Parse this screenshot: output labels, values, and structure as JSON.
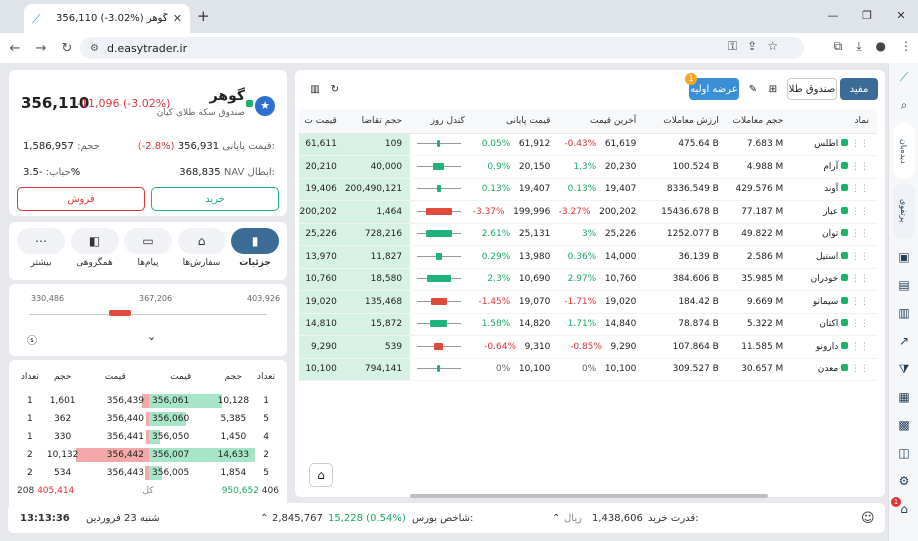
{
  "browser": {
    "tab_title": "356,110 (-3.02%) گوهر",
    "url": "d.easytrader.ir"
  },
  "stock": {
    "name": "گوهر",
    "subtitle": "صندوق سکه طلای کیان",
    "price": "356,110",
    "change": "-11,096 (-3.02%)",
    "final_price_label": "قیمت پایانی:",
    "final_price": "356,931",
    "final_change": "(-2.8%)",
    "volume_label": "حجم:",
    "volume": "1,586,957",
    "nav_label": "NAV ابطال:",
    "nav": "368,835",
    "bubble_label": "حباب:",
    "bubble": "-3.5%",
    "buy_label": "خرید",
    "sell_label": "فروش"
  },
  "panel_tabs": [
    {
      "label": "جزئیات",
      "icon": "chart-icon",
      "active": true
    },
    {
      "label": "سفارش‌ها",
      "icon": "basket-icon",
      "active": false
    },
    {
      "label": "پیام‌ها",
      "icon": "message-icon",
      "active": false
    },
    {
      "label": "همگروهی",
      "icon": "group-icon",
      "active": false
    },
    {
      "label": "بیشتر",
      "icon": "more-icon",
      "active": false
    }
  ],
  "range": {
    "low": "330,486",
    "mid": "367,206",
    "high": "403,926"
  },
  "orderbook": {
    "headers": {
      "count": "تعداد",
      "volume": "حجم",
      "price": "قیمت"
    },
    "rows": [
      {
        "buy_count": "1",
        "buy_vol": "10,128",
        "buy_price": "356,061",
        "sell_price": "356,439",
        "sell_vol": "1,601",
        "sell_count": "1",
        "buy_frac": 0.55,
        "sell_frac": 0.05
      },
      {
        "buy_count": "5",
        "buy_vol": "5,385",
        "buy_price": "356,060",
        "sell_price": "356,440",
        "sell_vol": "362",
        "sell_count": "1",
        "buy_frac": 0.28,
        "sell_frac": 0.02
      },
      {
        "buy_count": "4",
        "buy_vol": "1,450",
        "buy_price": "356,050",
        "sell_price": "356,441",
        "sell_vol": "330",
        "sell_count": "1",
        "buy_frac": 0.08,
        "sell_frac": 0.02
      },
      {
        "buy_count": "2",
        "buy_vol": "14,633",
        "buy_price": "356,007",
        "sell_price": "356,442",
        "sell_vol": "10,132",
        "sell_count": "2",
        "buy_frac": 0.8,
        "sell_frac": 0.55
      },
      {
        "buy_count": "5",
        "buy_vol": "1,854",
        "buy_price": "356,005",
        "sell_price": "356,443",
        "sell_vol": "534",
        "sell_count": "2",
        "buy_frac": 0.1,
        "sell_frac": 0.03
      }
    ],
    "total_label": "کل",
    "total_sell_count": "208",
    "total_sell": "405,414",
    "total_buy": "950,652",
    "total_buy_count": "406"
  },
  "toolbar": {
    "ipo_label": "عرضه اولیه",
    "ipo_badge": "1",
    "tab_gold": "صندوق طلا",
    "tab_mofid": "مفید"
  },
  "table": {
    "headers": [
      "نماد",
      "حجم معاملات",
      "ارزش معاملات",
      "آخرین قیمت",
      "قیمت پایانی",
      "کندل روز",
      "حجم تقاضا",
      "قیمت ت"
    ],
    "rows": [
      {
        "sym": "اطلس",
        "vol": "7.683 M",
        "val": "475.64 B",
        "last": "61,619",
        "last_pct": "-0.43%",
        "close": "61,912",
        "close_pct": "0.05%",
        "demand": "109",
        "dprice": "61,611"
      },
      {
        "sym": "آرام",
        "vol": "4.988 M",
        "val": "100.524 B",
        "last": "20,230",
        "last_pct": "1.3%",
        "close": "20,150",
        "close_pct": "0.9%",
        "demand": "40,000",
        "dprice": "20,210"
      },
      {
        "sym": "آوند",
        "vol": "429.576 M",
        "val": "8336.549 B",
        "last": "19,407",
        "last_pct": "0.13%",
        "close": "19,407",
        "close_pct": "0.13%",
        "demand": "200,490,121",
        "dprice": "19,406"
      },
      {
        "sym": "عیار",
        "vol": "77.187 M",
        "val": "15436.678 B",
        "last": "200,202",
        "last_pct": "-3.27%",
        "close": "199,996",
        "close_pct": "-3.37%",
        "demand": "1,464",
        "dprice": "200,202"
      },
      {
        "sym": "توان",
        "vol": "49.822 M",
        "val": "1252.077 B",
        "last": "25,226",
        "last_pct": "3%",
        "close": "25,131",
        "close_pct": "2.61%",
        "demand": "728,216",
        "dprice": "25,226"
      },
      {
        "sym": "استیل",
        "vol": "2.586 M",
        "val": "36.139 B",
        "last": "14,000",
        "last_pct": "0.36%",
        "close": "13,980",
        "close_pct": "0.29%",
        "demand": "11,827",
        "dprice": "13,970"
      },
      {
        "sym": "خودران",
        "vol": "35.985 M",
        "val": "384.606 B",
        "last": "10,760",
        "last_pct": "2.97%",
        "close": "10,690",
        "close_pct": "2.3%",
        "demand": "18,580",
        "dprice": "10,760"
      },
      {
        "sym": "سیمانو",
        "vol": "9.669 M",
        "val": "184.42 B",
        "last": "19,020",
        "last_pct": "-1.71%",
        "close": "19,070",
        "close_pct": "-1.45%",
        "demand": "135,468",
        "dprice": "19,020"
      },
      {
        "sym": "اکتان",
        "vol": "5.322 M",
        "val": "78.874 B",
        "last": "14,840",
        "last_pct": "1.71%",
        "close": "14,820",
        "close_pct": "1.58%",
        "demand": "15,872",
        "dprice": "14,810"
      },
      {
        "sym": "دارونو",
        "vol": "11.585 M",
        "val": "107.864 B",
        "last": "9,290",
        "last_pct": "-0.85%",
        "close": "9,310",
        "close_pct": "-0.64%",
        "demand": "539",
        "dprice": "9,290"
      },
      {
        "sym": "معدن",
        "vol": "30.657 M",
        "val": "309.527 B",
        "last": "10,100",
        "last_pct": "0%",
        "close": "10,100",
        "close_pct": "0%",
        "demand": "794,141",
        "dprice": "10,100"
      }
    ]
  },
  "statusbar": {
    "clock": "13:13:36",
    "date": "شنبه 23 فروردین",
    "index_label": "شاخص بورس:",
    "index_value": "2,845,767",
    "index_change": "15,228 (0.54%)",
    "power_label": "قدرت خرید:",
    "power_value": "1,438,606",
    "power_unit": "ریال"
  },
  "rail": {
    "tab1": "دیده‌بان",
    "tab2": "پرتفوی",
    "badge": "1"
  }
}
